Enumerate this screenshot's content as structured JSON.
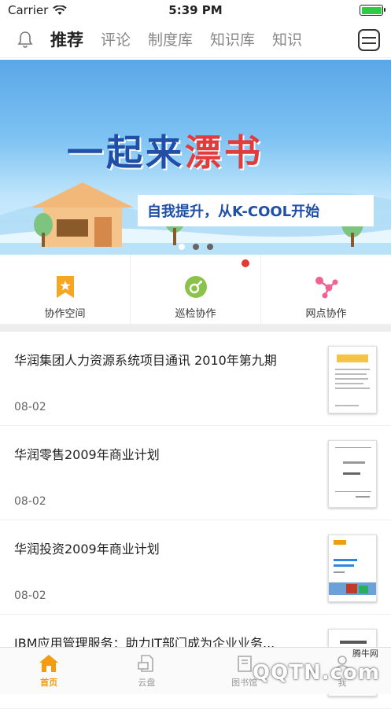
{
  "status_bar": {
    "carrier": "Carrier",
    "time": "5:39 PM"
  },
  "tabs": {
    "items": [
      "推荐",
      "评论",
      "制度库",
      "知识库",
      "知识"
    ],
    "active_index": 0
  },
  "banner": {
    "title_part1": "一起来",
    "title_part2": "漂书",
    "subtitle": "自我提升，从K-COOL开始",
    "page_count": 3,
    "active_page": 0
  },
  "quick_actions": [
    {
      "label": "协作空间",
      "icon": "bookmark-star-icon",
      "color": "#f5a623"
    },
    {
      "label": "巡检协作",
      "icon": "green-circle-icon",
      "color": "#8bc34a",
      "badge": true
    },
    {
      "label": "网点协作",
      "icon": "share-icon",
      "color": "#f06292"
    }
  ],
  "articles": [
    {
      "title": "华润集团人力资源系统项目通讯 2010年第九期",
      "date": "08-02"
    },
    {
      "title": "华润零售2009年商业计划",
      "date": "08-02"
    },
    {
      "title": "华润投资2009年商业计划",
      "date": "08-02"
    },
    {
      "title": "IBM应用管理服务：助力IT部门成为企业业务...",
      "date": ""
    }
  ],
  "bottom_nav": {
    "items": [
      "首页",
      "云盘",
      "图书馆",
      "我"
    ],
    "active_index": 0
  },
  "watermark": {
    "text": "QQTN.com",
    "small": "腾牛网"
  },
  "colors": {
    "accent": "#f39c12",
    "badge": "#e53935"
  }
}
